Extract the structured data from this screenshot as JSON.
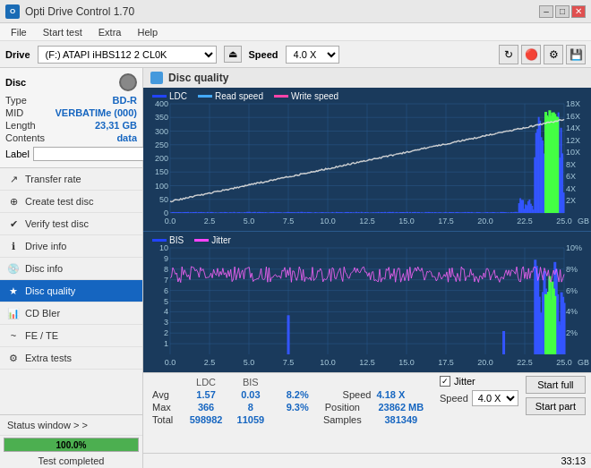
{
  "app": {
    "title": "Opti Drive Control 1.70",
    "icon": "O"
  },
  "title_controls": {
    "minimize": "–",
    "maximize": "□",
    "close": "✕"
  },
  "menu": {
    "items": [
      "File",
      "Start test",
      "Extra",
      "Help"
    ]
  },
  "drive_bar": {
    "label": "Drive",
    "drive_value": "(F:)  ATAPI iHBS112  2 CL0K",
    "speed_label": "Speed",
    "speed_value": "4.0 X"
  },
  "disc": {
    "title": "Disc",
    "type_label": "Type",
    "type_value": "BD-R",
    "mid_label": "MID",
    "mid_value": "VERBATIMe (000)",
    "length_label": "Length",
    "length_value": "23,31 GB",
    "contents_label": "Contents",
    "contents_value": "data",
    "label_label": "Label",
    "label_value": ""
  },
  "sidebar": {
    "items": [
      {
        "id": "transfer-rate",
        "label": "Transfer rate",
        "icon": "↗"
      },
      {
        "id": "create-test",
        "label": "Create test disc",
        "icon": "⊕"
      },
      {
        "id": "verify-test",
        "label": "Verify test disc",
        "icon": "✔"
      },
      {
        "id": "drive-info",
        "label": "Drive info",
        "icon": "ℹ"
      },
      {
        "id": "disc-info",
        "label": "Disc info",
        "icon": "💿"
      },
      {
        "id": "disc-quality",
        "label": "Disc quality",
        "icon": "★",
        "active": true
      },
      {
        "id": "cd-bier",
        "label": "CD BIer",
        "icon": "📊"
      },
      {
        "id": "fe-te",
        "label": "FE / TE",
        "icon": "~"
      },
      {
        "id": "extra-tests",
        "label": "Extra tests",
        "icon": "⚙"
      }
    ]
  },
  "status": {
    "window_label": "Status window > >",
    "progress_value": "100.0%",
    "completed_label": "Test completed",
    "time": "33:13"
  },
  "chart": {
    "title": "Disc quality",
    "legend1": {
      "ldc": "LDC",
      "read": "Read speed",
      "write": "Write speed"
    },
    "legend2": {
      "bis": "BIS",
      "jitter": "Jitter"
    },
    "top_y_max": 400,
    "top_y_right_max": 18,
    "bottom_y_max": 10,
    "bottom_y_right_max": 10,
    "x_max": 25.0
  },
  "stats": {
    "headers": [
      "LDC",
      "BIS",
      "",
      "Jitter",
      "Speed",
      ""
    ],
    "avg_label": "Avg",
    "avg_ldc": "1.57",
    "avg_bis": "0.03",
    "avg_jitter": "8.2%",
    "avg_speed": "4.18 X",
    "max_label": "Max",
    "max_ldc": "366",
    "max_bis": "8",
    "max_jitter": "9.3%",
    "total_label": "Total",
    "total_ldc": "598982",
    "total_bis": "11059",
    "position_label": "Position",
    "position_value": "23862 MB",
    "samples_label": "Samples",
    "samples_value": "381349",
    "speed_select": "4.0 X",
    "start_full": "Start full",
    "start_part": "Start part"
  }
}
